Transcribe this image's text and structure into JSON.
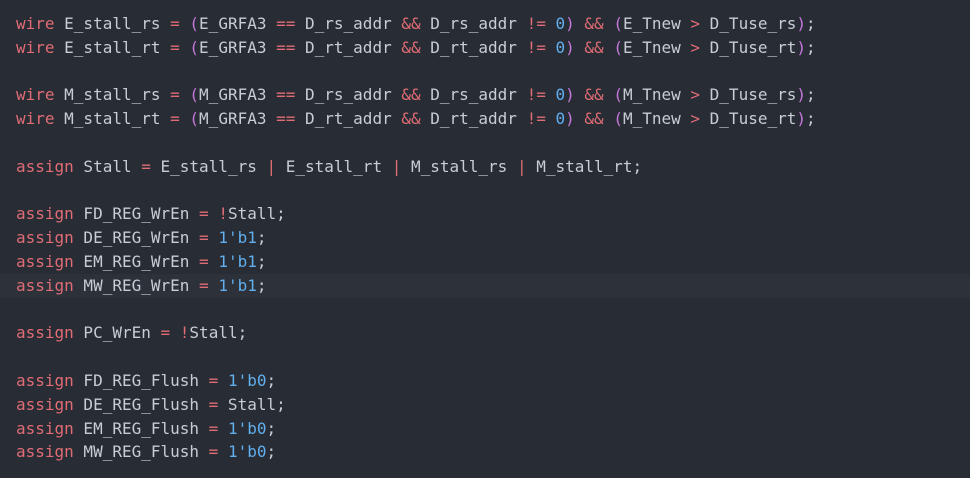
{
  "editor": {
    "lines": [
      [
        [
          "kw",
          "wire"
        ],
        [
          "id",
          " E_stall_rs "
        ],
        [
          "op",
          "="
        ],
        [
          "id",
          " "
        ],
        [
          "paren",
          "("
        ],
        [
          "id",
          "E_GRFA3 "
        ],
        [
          "op",
          "=="
        ],
        [
          "id",
          " D_rs_addr "
        ],
        [
          "op",
          "&&"
        ],
        [
          "id",
          " D_rs_addr "
        ],
        [
          "op",
          "!="
        ],
        [
          "id",
          " "
        ],
        [
          "num",
          "0"
        ],
        [
          "paren",
          ")"
        ],
        [
          "id",
          " "
        ],
        [
          "op",
          "&&"
        ],
        [
          "id",
          " "
        ],
        [
          "paren",
          "("
        ],
        [
          "id",
          "E_Tnew "
        ],
        [
          "op",
          ">"
        ],
        [
          "id",
          " D_Tuse_rs"
        ],
        [
          "paren",
          ")"
        ],
        [
          "id",
          ";"
        ]
      ],
      [
        [
          "kw",
          "wire"
        ],
        [
          "id",
          " E_stall_rt "
        ],
        [
          "op",
          "="
        ],
        [
          "id",
          " "
        ],
        [
          "paren",
          "("
        ],
        [
          "id",
          "E_GRFA3 "
        ],
        [
          "op",
          "=="
        ],
        [
          "id",
          " D_rt_addr "
        ],
        [
          "op",
          "&&"
        ],
        [
          "id",
          " D_rt_addr "
        ],
        [
          "op",
          "!="
        ],
        [
          "id",
          " "
        ],
        [
          "num",
          "0"
        ],
        [
          "paren",
          ")"
        ],
        [
          "id",
          " "
        ],
        [
          "op",
          "&&"
        ],
        [
          "id",
          " "
        ],
        [
          "paren",
          "("
        ],
        [
          "id",
          "E_Tnew "
        ],
        [
          "op",
          ">"
        ],
        [
          "id",
          " D_Tuse_rt"
        ],
        [
          "paren",
          ")"
        ],
        [
          "id",
          ";"
        ]
      ],
      [],
      [
        [
          "kw",
          "wire"
        ],
        [
          "id",
          " M_stall_rs "
        ],
        [
          "op",
          "="
        ],
        [
          "id",
          " "
        ],
        [
          "paren",
          "("
        ],
        [
          "id",
          "M_GRFA3 "
        ],
        [
          "op",
          "=="
        ],
        [
          "id",
          " D_rs_addr "
        ],
        [
          "op",
          "&&"
        ],
        [
          "id",
          " D_rs_addr "
        ],
        [
          "op",
          "!="
        ],
        [
          "id",
          " "
        ],
        [
          "num",
          "0"
        ],
        [
          "paren",
          ")"
        ],
        [
          "id",
          " "
        ],
        [
          "op",
          "&&"
        ],
        [
          "id",
          " "
        ],
        [
          "paren",
          "("
        ],
        [
          "id",
          "M_Tnew "
        ],
        [
          "op",
          ">"
        ],
        [
          "id",
          " D_Tuse_rs"
        ],
        [
          "paren",
          ")"
        ],
        [
          "id",
          ";"
        ]
      ],
      [
        [
          "kw",
          "wire"
        ],
        [
          "id",
          " M_stall_rt "
        ],
        [
          "op",
          "="
        ],
        [
          "id",
          " "
        ],
        [
          "paren",
          "("
        ],
        [
          "id",
          "M_GRFA3 "
        ],
        [
          "op",
          "=="
        ],
        [
          "id",
          " D_rt_addr "
        ],
        [
          "op",
          "&&"
        ],
        [
          "id",
          " D_rt_addr "
        ],
        [
          "op",
          "!="
        ],
        [
          "id",
          " "
        ],
        [
          "num",
          "0"
        ],
        [
          "paren",
          ")"
        ],
        [
          "id",
          " "
        ],
        [
          "op",
          "&&"
        ],
        [
          "id",
          " "
        ],
        [
          "paren",
          "("
        ],
        [
          "id",
          "M_Tnew "
        ],
        [
          "op",
          ">"
        ],
        [
          "id",
          " D_Tuse_rt"
        ],
        [
          "paren",
          ")"
        ],
        [
          "id",
          ";"
        ]
      ],
      [],
      [
        [
          "kw",
          "assign"
        ],
        [
          "id",
          " Stall "
        ],
        [
          "op",
          "="
        ],
        [
          "id",
          " E_stall_rs "
        ],
        [
          "op",
          "|"
        ],
        [
          "id",
          " E_stall_rt "
        ],
        [
          "op",
          "|"
        ],
        [
          "id",
          " M_stall_rs "
        ],
        [
          "op",
          "|"
        ],
        [
          "id",
          " M_stall_rt;"
        ]
      ],
      [],
      [
        [
          "kw",
          "assign"
        ],
        [
          "id",
          " FD_REG_WrEn "
        ],
        [
          "op",
          "="
        ],
        [
          "id",
          " "
        ],
        [
          "op",
          "!"
        ],
        [
          "id",
          "Stall;"
        ]
      ],
      [
        [
          "kw",
          "assign"
        ],
        [
          "id",
          " DE_REG_WrEn "
        ],
        [
          "op",
          "="
        ],
        [
          "id",
          " "
        ],
        [
          "num",
          "1'b1"
        ],
        [
          "id",
          ";"
        ]
      ],
      [
        [
          "kw",
          "assign"
        ],
        [
          "id",
          " EM_REG_WrEn "
        ],
        [
          "op",
          "="
        ],
        [
          "id",
          " "
        ],
        [
          "num",
          "1'b1"
        ],
        [
          "id",
          ";"
        ]
      ],
      [
        [
          "kw",
          "assign"
        ],
        [
          "id",
          " MW_REG_WrEn "
        ],
        [
          "op",
          "="
        ],
        [
          "id",
          " "
        ],
        [
          "num",
          "1'b1"
        ],
        [
          "id",
          ";"
        ]
      ],
      [],
      [
        [
          "kw",
          "assign"
        ],
        [
          "id",
          " PC_WrEn "
        ],
        [
          "op",
          "="
        ],
        [
          "id",
          " "
        ],
        [
          "op",
          "!"
        ],
        [
          "id",
          "Stall;"
        ]
      ],
      [],
      [
        [
          "kw",
          "assign"
        ],
        [
          "id",
          " FD_REG_Flush "
        ],
        [
          "op",
          "="
        ],
        [
          "id",
          " "
        ],
        [
          "num",
          "1'b0"
        ],
        [
          "id",
          ";"
        ]
      ],
      [
        [
          "kw",
          "assign"
        ],
        [
          "id",
          " DE_REG_Flush "
        ],
        [
          "op",
          "="
        ],
        [
          "id",
          " Stall;"
        ]
      ],
      [
        [
          "kw",
          "assign"
        ],
        [
          "id",
          " EM_REG_Flush "
        ],
        [
          "op",
          "="
        ],
        [
          "id",
          " "
        ],
        [
          "num",
          "1'b0"
        ],
        [
          "id",
          ";"
        ]
      ],
      [
        [
          "kw",
          "assign"
        ],
        [
          "id",
          " MW_REG_Flush "
        ],
        [
          "op",
          "="
        ],
        [
          "id",
          " "
        ],
        [
          "num",
          "1'b0"
        ],
        [
          "id",
          ";"
        ]
      ]
    ],
    "current_line_index": 11
  },
  "colors": {
    "background": "#282c34",
    "current_line": "#2c313a",
    "keyword": "#e06c75",
    "operator": "#e06c75",
    "number": "#61afef",
    "paren": "#c678dd",
    "identifier": "#c8ccd4"
  }
}
